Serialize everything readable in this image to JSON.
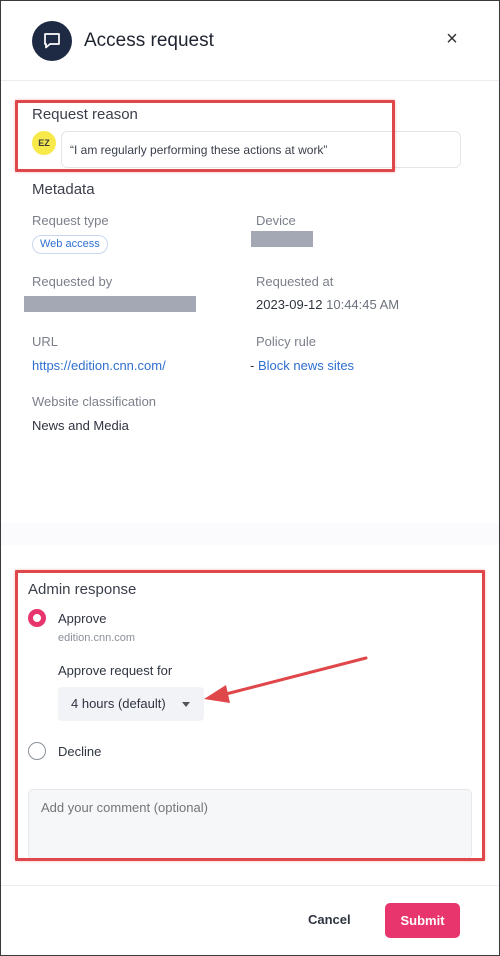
{
  "header": {
    "title": "Access request",
    "icon": "chat-bubble-icon",
    "close_label": "×"
  },
  "request_reason": {
    "label": "Request reason",
    "avatar_initials": "EZ",
    "text": "“I am regularly performing these actions at work”"
  },
  "metadata": {
    "label": "Metadata",
    "request_type_label": "Request type",
    "request_type_value": "Web access",
    "device_label": "Device",
    "requested_by_label": "Requested by",
    "requested_at_label": "Requested at",
    "requested_at_date": "2023-09-12",
    "requested_at_time": "10:44:45 AM",
    "url_label": "URL",
    "url_value": "https://edition.cnn.com/",
    "policy_rule_label": "Policy rule",
    "policy_rule_prefix": "-",
    "policy_rule_value": "Block news sites",
    "classification_label": "Website classification",
    "classification_value": "News and Media"
  },
  "admin_response": {
    "label": "Admin response",
    "approve_label": "Approve",
    "approve_domain": "edition.cnn.com",
    "approve_for_label": "Approve request for",
    "approve_for_value": "4 hours (default)",
    "decline_label": "Decline",
    "comment_placeholder": "Add your comment (optional)"
  },
  "footer": {
    "cancel_label": "Cancel",
    "submit_label": "Submit"
  },
  "colors": {
    "accent": "#e8356d",
    "link": "#2f6fd0",
    "annotation": "#e0474a",
    "header_icon_bg": "#1e2a44"
  }
}
